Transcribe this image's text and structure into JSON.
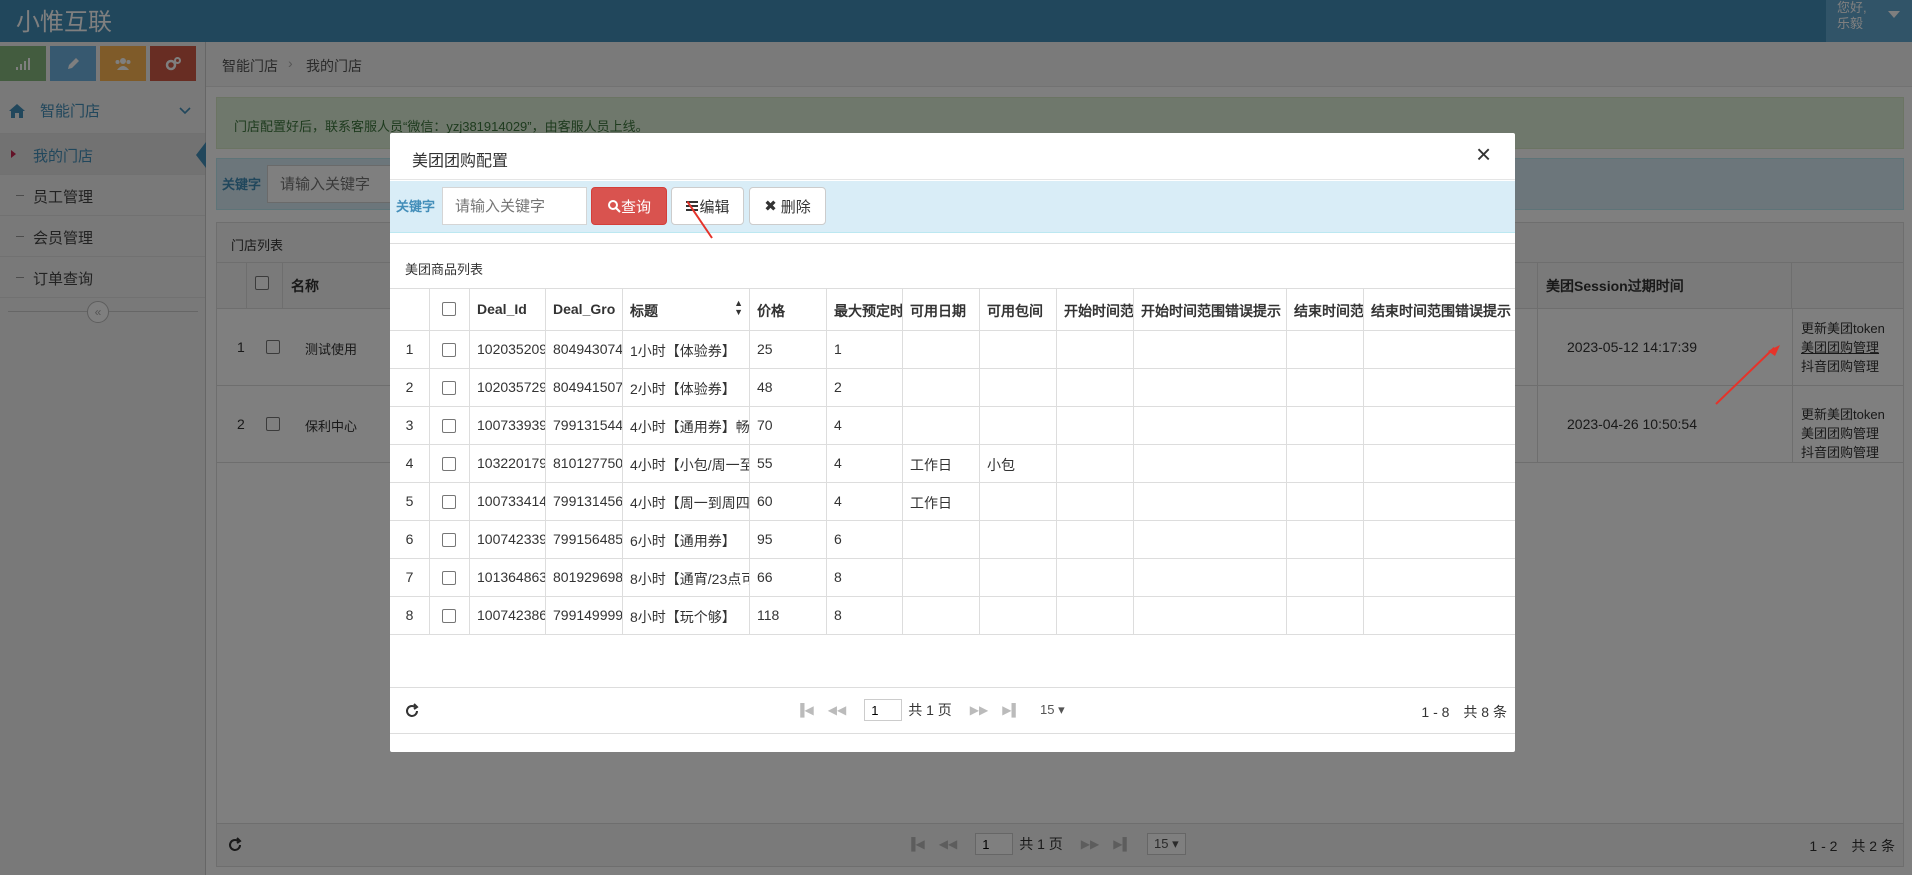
{
  "brand": "小惟互联",
  "user": {
    "greeting": "您好,",
    "name": "乐毅"
  },
  "colors": {
    "topbar": "#438eb9",
    "danger": "#d9534f",
    "success": "#87b87f",
    "info": "#6fb3e0",
    "warning": "#ffb752",
    "red": "#d15b47"
  },
  "shortcuts": [
    {
      "icon": "signal-icon",
      "color": "#87b87f"
    },
    {
      "icon": "pencil-icon",
      "color": "#6fb3e0"
    },
    {
      "icon": "users-icon",
      "color": "#ffb752"
    },
    {
      "icon": "cogs-icon",
      "color": "#d15b47"
    }
  ],
  "sidebar": {
    "group": "智能门店",
    "items": [
      {
        "label": "我的门店",
        "active": true
      },
      {
        "label": "员工管理",
        "active": false
      },
      {
        "label": "会员管理",
        "active": false
      },
      {
        "label": "订单查询",
        "active": false
      }
    ]
  },
  "breadcrumb": {
    "root": "智能门店",
    "current": "我的门店"
  },
  "alert": "门店配置好后，联系客服人员“微信：yzj381914029”，由客服人员上线。",
  "search": {
    "label": "关键字",
    "placeholder": "请输入关键字"
  },
  "store_panel": {
    "title": "门店列表",
    "col_name": "名称",
    "col_session": "美团Session过期时间",
    "rows": [
      {
        "num": "1",
        "name": "测试使用",
        "session": "2023-05-12 14:17:39",
        "actions": [
          "更新美团token",
          "美团团购管理",
          "抖音团购管理"
        ]
      },
      {
        "num": "2",
        "name": "保利中心",
        "session": "2023-04-26 10:50:54",
        "actions": [
          "更新美团token",
          "美团团购管理",
          "抖音团购管理"
        ]
      }
    ],
    "pager": {
      "page": "1",
      "total_pages": "共 1 页",
      "page_size": "15",
      "summary": "1 - 2　共 2 条"
    }
  },
  "modal": {
    "title": "美团团购配置",
    "close": "×",
    "search_label": "关键字",
    "search_placeholder": "请输入关键字",
    "btn_query": "查询",
    "btn_edit": "编辑",
    "btn_delete": "删除",
    "panel_title": "美团商品列表",
    "columns": [
      "Deal_Id",
      "Deal_Gro",
      "标题",
      "价格",
      "最大预定时",
      "可用日期",
      "可用包间",
      "开始时间范",
      "开始时间范围错误提示",
      "结束时间范",
      "结束时间范围错误提示"
    ],
    "rows": [
      {
        "num": "1",
        "deal_id": "102035209",
        "deal_group": "804943074",
        "title": "1小时【体验券】",
        "price": "25",
        "max": "1",
        "date": "",
        "room": ""
      },
      {
        "num": "2",
        "deal_id": "102035729",
        "deal_group": "804941507",
        "title": "2小时【体验券】",
        "price": "48",
        "max": "2",
        "date": "",
        "room": ""
      },
      {
        "num": "3",
        "deal_id": "100733939",
        "deal_group": "799131544",
        "title": "4小时【通用券】畅",
        "price": "70",
        "max": "4",
        "date": "",
        "room": ""
      },
      {
        "num": "4",
        "deal_id": "103220179",
        "deal_group": "810127750",
        "title": "4小时【小包/周一至",
        "price": "55",
        "max": "4",
        "date": "工作日",
        "room": "小包"
      },
      {
        "num": "5",
        "deal_id": "100733414",
        "deal_group": "799131456",
        "title": "4小时【周一到周四",
        "price": "60",
        "max": "4",
        "date": "工作日",
        "room": ""
      },
      {
        "num": "6",
        "deal_id": "100742339",
        "deal_group": "799156485",
        "title": "6小时【通用券】",
        "price": "95",
        "max": "6",
        "date": "",
        "room": ""
      },
      {
        "num": "7",
        "deal_id": "101364863",
        "deal_group": "801929698",
        "title": "8小时【通宵/23点可",
        "price": "66",
        "max": "8",
        "date": "",
        "room": ""
      },
      {
        "num": "8",
        "deal_id": "100742386",
        "deal_group": "799149999",
        "title": "8小时【玩个够】",
        "price": "118",
        "max": "8",
        "date": "",
        "room": ""
      }
    ],
    "pager": {
      "page": "1",
      "total_pages": "共 1 页",
      "page_size": "15",
      "summary": "1 - 8　共 8 条"
    }
  }
}
